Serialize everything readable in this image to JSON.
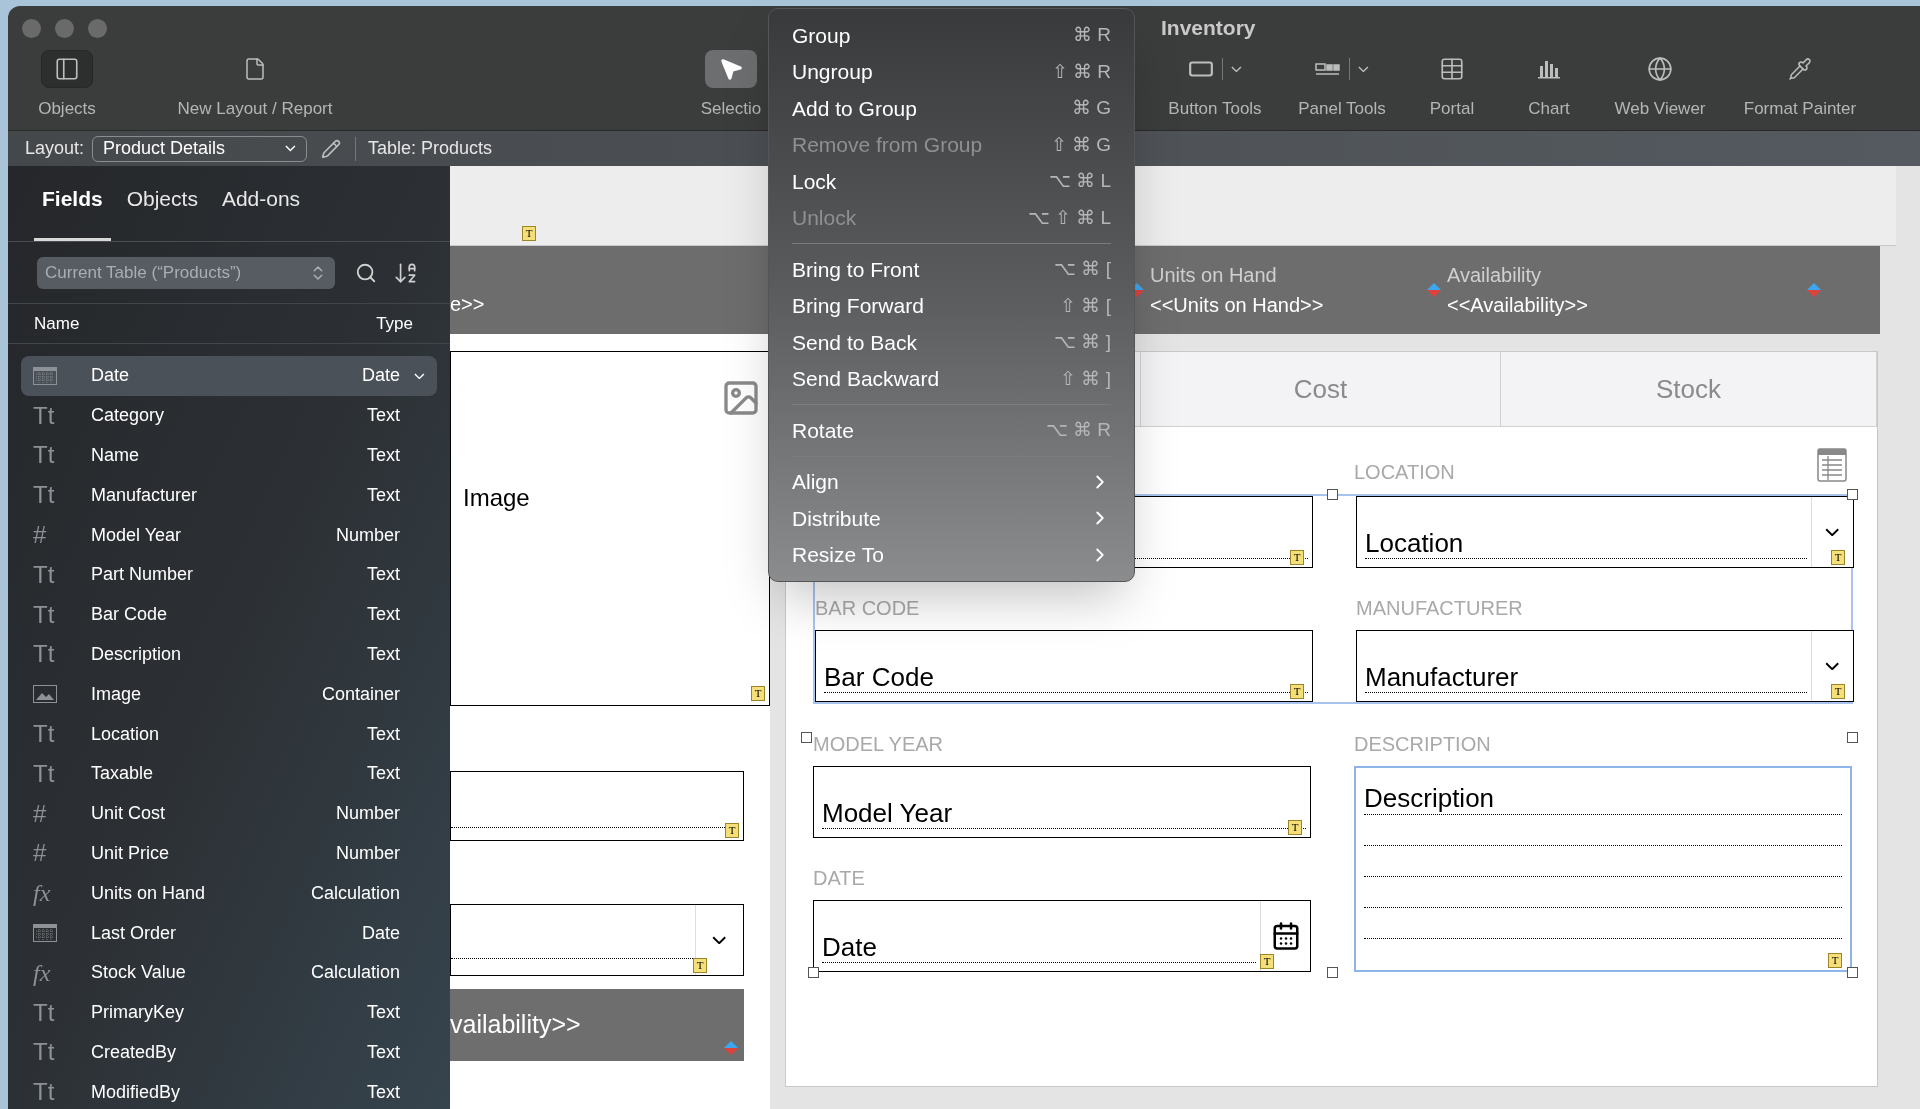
{
  "window": {
    "title": "Inventory"
  },
  "toolbar": [
    {
      "label": "Objects",
      "selected": false,
      "toggled": true,
      "has_menu": false
    },
    {
      "label": "New Layout / Report",
      "selected": false,
      "toggled": false,
      "has_menu": false
    },
    {
      "label": "Selectio",
      "selected": true,
      "toggled": false,
      "has_menu": false
    },
    {
      "label": "Button Tools",
      "selected": false,
      "toggled": false,
      "has_menu": true
    },
    {
      "label": "Panel Tools",
      "selected": false,
      "toggled": false,
      "has_menu": true
    },
    {
      "label": "Portal",
      "selected": false,
      "toggled": false,
      "has_menu": false
    },
    {
      "label": "Chart",
      "selected": false,
      "toggled": false,
      "has_menu": false
    },
    {
      "label": "Web Viewer",
      "selected": false,
      "toggled": false,
      "has_menu": false
    },
    {
      "label": "Format Painter",
      "selected": false,
      "toggled": false,
      "has_menu": false
    }
  ],
  "layout_bar": {
    "label": "Layout:",
    "layout": "Product Details",
    "table": "Table: Products"
  },
  "sidebar": {
    "tabs": [
      {
        "label": "Fields",
        "selected": true
      },
      {
        "label": "Objects",
        "selected": false
      },
      {
        "label": "Add-ons",
        "selected": false
      }
    ],
    "table_selector": "Current Table (“Products”)",
    "columns": [
      "Name",
      "Type"
    ],
    "fields": [
      {
        "name": "Date",
        "type": "Date",
        "kind": "date",
        "selected": true
      },
      {
        "name": "Category",
        "type": "Text",
        "kind": "text",
        "glyph": "Tt",
        "selected": false
      },
      {
        "name": "Name",
        "type": "Text",
        "kind": "text",
        "glyph": "Tt",
        "selected": false
      },
      {
        "name": "Manufacturer",
        "type": "Text",
        "kind": "text",
        "glyph": "Tt",
        "selected": false
      },
      {
        "name": "Model Year",
        "type": "Number",
        "kind": "number",
        "glyph": "#",
        "selected": false
      },
      {
        "name": "Part Number",
        "type": "Text",
        "kind": "text",
        "glyph": "Tt",
        "selected": false
      },
      {
        "name": "Bar Code",
        "type": "Text",
        "kind": "text",
        "glyph": "Tt",
        "selected": false
      },
      {
        "name": "Description",
        "type": "Text",
        "kind": "text",
        "glyph": "Tt",
        "selected": false
      },
      {
        "name": "Image",
        "type": "Container",
        "kind": "container",
        "selected": false
      },
      {
        "name": "Location",
        "type": "Text",
        "kind": "text",
        "glyph": "Tt",
        "selected": false
      },
      {
        "name": "Taxable",
        "type": "Text",
        "kind": "text",
        "glyph": "Tt",
        "selected": false
      },
      {
        "name": "Unit Cost",
        "type": "Number",
        "kind": "number",
        "glyph": "#",
        "selected": false
      },
      {
        "name": "Unit Price",
        "type": "Number",
        "kind": "number",
        "glyph": "#",
        "selected": false
      },
      {
        "name": "Units on Hand",
        "type": "Calculation",
        "kind": "calculation",
        "glyph": "fx",
        "selected": false
      },
      {
        "name": "Last Order",
        "type": "Date",
        "kind": "date",
        "selected": false
      },
      {
        "name": "Stock Value",
        "type": "Calculation",
        "kind": "calculation",
        "glyph": "fx",
        "selected": false
      },
      {
        "name": "PrimaryKey",
        "type": "Text",
        "kind": "text",
        "glyph": "Tt",
        "selected": false
      },
      {
        "name": "CreatedBy",
        "type": "Text",
        "kind": "text",
        "glyph": "Tt",
        "selected": false
      },
      {
        "name": "ModifiedBy",
        "type": "Text",
        "kind": "text",
        "glyph": "Tt",
        "selected": false
      }
    ]
  },
  "canvas": {
    "top_badge": "T",
    "header": [
      {
        "value": "e>>"
      },
      {
        "label": "Units on Hand",
        "value": "<<Units on Hand>>"
      },
      {
        "label": "Availability",
        "value": "<<Availability>>"
      }
    ],
    "left": [
      {
        "kind": "container",
        "label": "Image",
        "badge": "T"
      },
      {
        "kind": "text",
        "badge": "T"
      },
      {
        "kind": "dropdown",
        "badge": "T"
      },
      {
        "kind": "merge",
        "value": "vailability>>"
      }
    ],
    "tabs": [
      {
        "label": "Cost",
        "selected": false
      },
      {
        "label": "Stock",
        "selected": false
      }
    ],
    "group_selected": true,
    "fields": [
      {
        "kind": "text",
        "badge": "T",
        "selected": false
      },
      {
        "kind": "dropdown",
        "label": "LOCATION",
        "value": "Location",
        "badge": "T",
        "selected": false
      },
      {
        "kind": "text",
        "label": "BAR CODE",
        "value": "Bar Code",
        "badge": "T",
        "selected": false
      },
      {
        "kind": "dropdown",
        "label": "MANUFACTURER",
        "value": "Manufacturer",
        "badge": "T",
        "selected": false
      },
      {
        "kind": "text",
        "label": "MODEL YEAR",
        "value": "Model Year",
        "badge": "T",
        "selected": false
      },
      {
        "kind": "date",
        "label": "DATE",
        "value": "Date",
        "badge": "T",
        "selected": false
      },
      {
        "kind": "multiline",
        "label": "DESCRIPTION",
        "value": "Description",
        "badge": "T",
        "selected": true
      }
    ]
  },
  "menu": [
    {
      "kind": "item",
      "label": "Group",
      "shortcut": "⌘ R",
      "disabled": false
    },
    {
      "kind": "item",
      "label": "Ungroup",
      "shortcut": "⇧ ⌘ R",
      "disabled": false
    },
    {
      "kind": "item",
      "label": "Add to Group",
      "shortcut": "⌘ G",
      "disabled": false
    },
    {
      "kind": "item",
      "label": "Remove from Group",
      "shortcut": "⇧ ⌘ G",
      "disabled": true
    },
    {
      "kind": "item",
      "label": "Lock",
      "shortcut": "⌥ ⌘ L",
      "disabled": false
    },
    {
      "kind": "item",
      "label": "Unlock",
      "shortcut": "⌥ ⇧ ⌘ L",
      "disabled": true
    },
    {
      "kind": "separator"
    },
    {
      "kind": "item",
      "label": "Bring to Front",
      "shortcut": "⌥ ⌘ [",
      "disabled": false
    },
    {
      "kind": "item",
      "label": "Bring Forward",
      "shortcut": "⇧ ⌘ [",
      "disabled": false
    },
    {
      "kind": "item",
      "label": "Send to Back",
      "shortcut": "⌥ ⌘ ]",
      "disabled": false
    },
    {
      "kind": "item",
      "label": "Send Backward",
      "shortcut": "⇧ ⌘ ]",
      "disabled": false
    },
    {
      "kind": "separator"
    },
    {
      "kind": "item",
      "label": "Rotate",
      "shortcut": "⌥ ⌘ R",
      "disabled": false
    },
    {
      "kind": "separator"
    },
    {
      "kind": "submenu",
      "label": "Align",
      "disabled": false
    },
    {
      "kind": "submenu",
      "label": "Distribute",
      "disabled": false
    },
    {
      "kind": "submenu",
      "label": "Resize To",
      "disabled": false
    }
  ]
}
